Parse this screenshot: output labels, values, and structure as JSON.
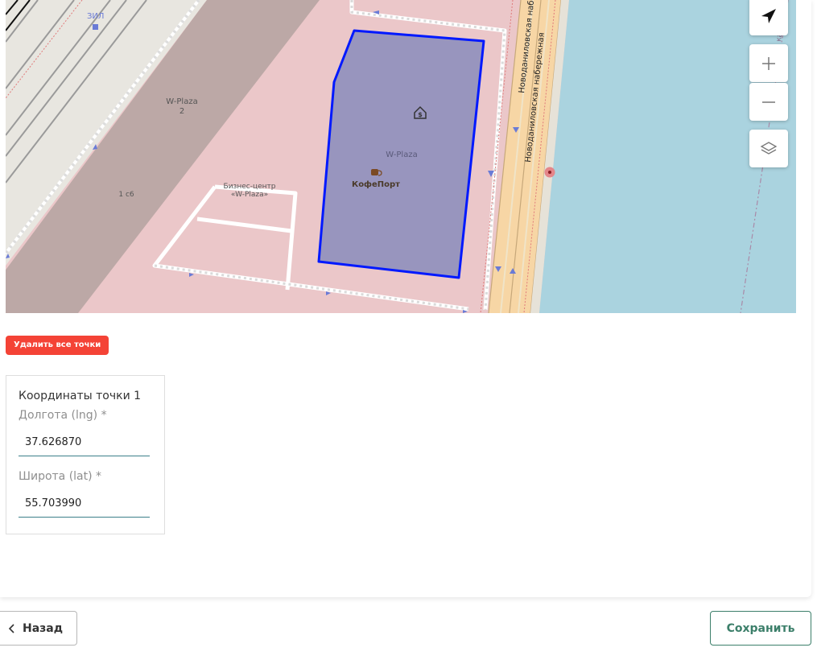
{
  "map": {
    "labels": {
      "zil": "ЗИЛ",
      "wplaza2_line1": "W-Plaza",
      "wplaza2_line2": "2",
      "building_1c6": "1 с6",
      "bc_line1": "Бизнес-центр",
      "bc_line2": "«W-Plaza»",
      "wplaza": "W-Plaza",
      "cafe": "КофеПорт",
      "street1": "Новоданиловская набер",
      "street2": "Новоданиловская набережная",
      "district": "ка-район"
    },
    "polygon_color": "#0019ff",
    "controls": {
      "locate": "navigation-arrow-icon",
      "zoom_in": "plus-icon",
      "zoom_out": "minus-icon",
      "layers": "layers-icon"
    }
  },
  "actions": {
    "delete_points": "Удалить все точки"
  },
  "coords": {
    "title": "Координаты точки 1",
    "lng_label": "Долгота (lng) *",
    "lng_value": "37.626870",
    "lat_label": "Широта (lat) *",
    "lat_value": "55.703990"
  },
  "footer": {
    "back": "Назад",
    "save": "Сохранить"
  },
  "colors": {
    "danger": "#f44336",
    "accent": "#3c7f6a",
    "water": "#aad3df",
    "industrial": "#ebc7c9"
  }
}
